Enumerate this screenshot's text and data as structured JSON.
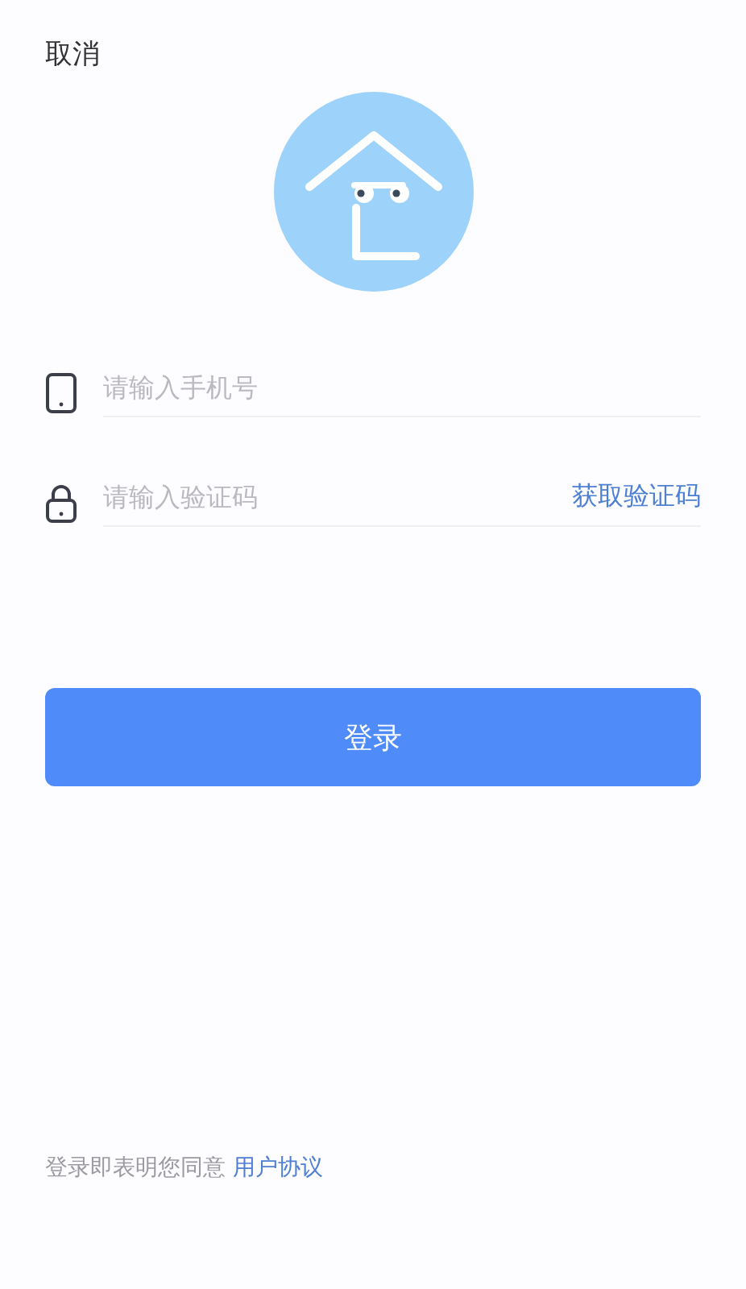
{
  "header": {
    "cancel": "取消"
  },
  "fields": [
    {
      "kind": "phone",
      "placeholder": "请输入手机号"
    },
    {
      "kind": "code",
      "placeholder": "请输入验证码",
      "action": "获取验证码"
    }
  ],
  "login_button": "登录",
  "footer": {
    "text": "登录即表明您同意",
    "link": "用户协议"
  }
}
